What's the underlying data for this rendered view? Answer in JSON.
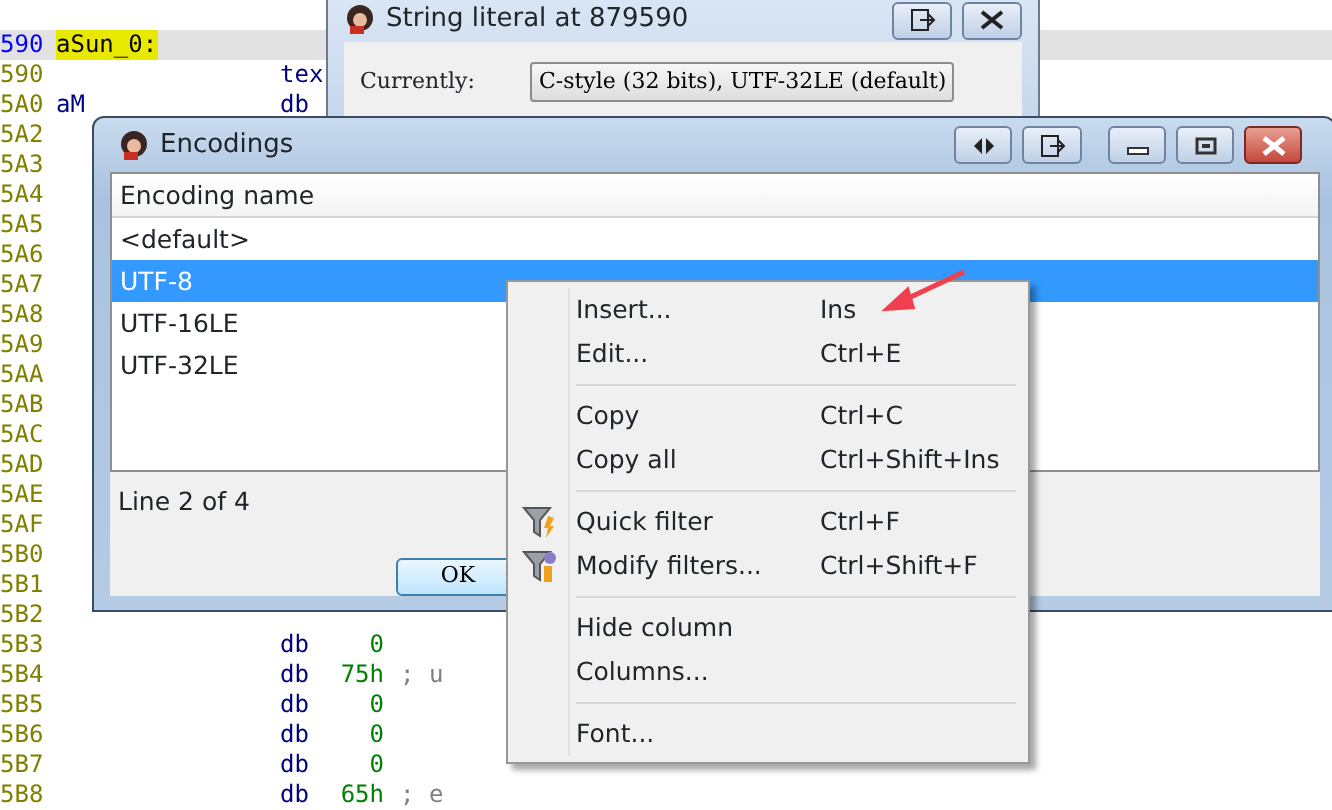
{
  "listing": [
    {
      "address": "590",
      "label": "aSun_0:",
      "current": true
    },
    {
      "address": "590",
      "mnemonic": "tex",
      "current": false
    },
    {
      "address": "5A0",
      "label": "aM",
      "mnemonic": "db",
      "current": false
    },
    {
      "address": "5A2",
      "current": false
    },
    {
      "address": "5A3",
      "current": false
    },
    {
      "address": "5A4",
      "current": false
    },
    {
      "address": "5A5",
      "current": false
    },
    {
      "address": "5A6",
      "current": false
    },
    {
      "address": "5A7",
      "current": false
    },
    {
      "address": "5A8",
      "current": false
    },
    {
      "address": "5A9",
      "current": false
    },
    {
      "address": "5AA",
      "current": false
    },
    {
      "address": "5AB",
      "current": false
    },
    {
      "address": "5AC",
      "current": false
    },
    {
      "address": "5AD",
      "current": false
    },
    {
      "address": "5AE",
      "current": false
    },
    {
      "address": "5AF",
      "current": false
    },
    {
      "address": "5B0",
      "current": false
    },
    {
      "address": "5B1",
      "current": false
    },
    {
      "address": "5B2",
      "current": false
    },
    {
      "address": "5B3",
      "mnemonic": "db",
      "operand": "0",
      "current": false
    },
    {
      "address": "5B4",
      "mnemonic": "db",
      "operand": "75h",
      "comment": "; u",
      "current": false
    },
    {
      "address": "5B5",
      "mnemonic": "db",
      "operand": "0",
      "current": false
    },
    {
      "address": "5B6",
      "mnemonic": "db",
      "operand": "0",
      "current": false
    },
    {
      "address": "5B7",
      "mnemonic": "db",
      "operand": "0",
      "current": false
    },
    {
      "address": "5B8",
      "mnemonic": "db",
      "operand": "65h",
      "comment": "; e",
      "current": false
    }
  ],
  "string_literal_dialog": {
    "title": "String literal at 879590",
    "currently_label": "Currently:",
    "currently_value": "C-style (32 bits), UTF-32LE (default)"
  },
  "encodings_window": {
    "title": "Encodings",
    "column_header": "Encoding name",
    "rows": [
      {
        "name": "<default>",
        "selected": false
      },
      {
        "name": "UTF-8",
        "selected": true
      },
      {
        "name": "UTF-16LE",
        "selected": false
      },
      {
        "name": "UTF-32LE",
        "selected": false
      }
    ],
    "status": "Line 2 of 4",
    "ok_button": "OK"
  },
  "context_menu": {
    "items": [
      {
        "kind": "plain",
        "label": "Insert...",
        "shortcut": "Ins"
      },
      {
        "kind": "plain",
        "label": "Edit...",
        "shortcut": "Ctrl+E"
      },
      {
        "kind": "separator"
      },
      {
        "kind": "plain",
        "label": "Copy",
        "shortcut": "Ctrl+C"
      },
      {
        "kind": "plain",
        "label": "Copy all",
        "shortcut": "Ctrl+Shift+Ins"
      },
      {
        "kind": "separator"
      },
      {
        "kind": "quick-filter",
        "label": "Quick filter",
        "shortcut": "Ctrl+F"
      },
      {
        "kind": "modify-filter",
        "label": "Modify filters...",
        "shortcut": "Ctrl+Shift+F"
      },
      {
        "kind": "separator"
      },
      {
        "kind": "plain",
        "label": "Hide column"
      },
      {
        "kind": "plain",
        "label": "Columns..."
      },
      {
        "kind": "separator"
      },
      {
        "kind": "plain",
        "label": "Font..."
      }
    ]
  }
}
